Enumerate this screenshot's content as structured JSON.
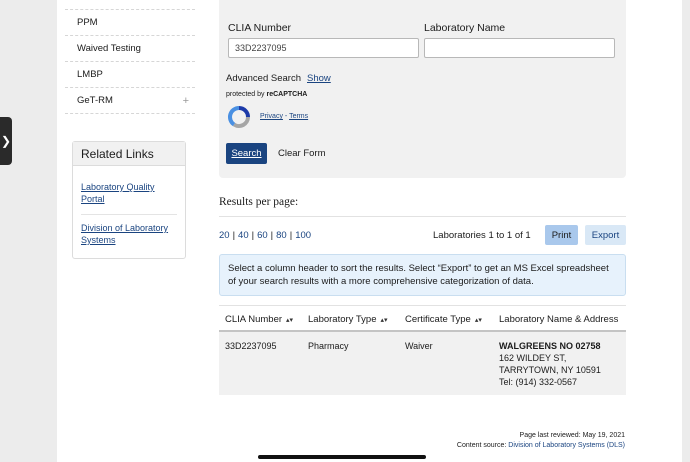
{
  "nav": {
    "items": [
      {
        "label": "PPM",
        "expandable": false
      },
      {
        "label": "Waived Testing",
        "expandable": false
      },
      {
        "label": "LMBP",
        "expandable": false
      },
      {
        "label": "GeT-RM",
        "expandable": true
      }
    ],
    "expand_symbol": "+"
  },
  "related_links": {
    "title": "Related Links",
    "links": [
      "Laboratory Quality Portal",
      "Division of Laboratory Systems"
    ]
  },
  "search": {
    "clia_label": "CLIA Number",
    "clia_value": "33D2237095",
    "lab_name_label": "Laboratory Name",
    "lab_name_value": "",
    "advanced_label": "Advanced Search",
    "advanced_toggle": "Show",
    "protected_prefix": "protected by",
    "protected_brand": "reCAPTCHA",
    "privacy": "Privacy",
    "terms": "Terms",
    "privacy_sep": " - ",
    "search_button": "Search",
    "clear_button": "Clear Form"
  },
  "results": {
    "per_page_label": "Results per page:",
    "page_sizes": [
      "20",
      "40",
      "60",
      "80",
      "100"
    ],
    "count_text": "Laboratories 1 to 1 of 1",
    "print_button": "Print",
    "export_button": "Export",
    "info_text": "Select a column header to sort the results. Select “Export” to get an MS Excel spreadsheet of your search results with a more comprehensive categorization of data.",
    "columns": [
      "CLIA Number",
      "Laboratory Type",
      "Certificate Type",
      "Laboratory Name & Address"
    ],
    "rows": [
      {
        "clia": "33D2237095",
        "lab_type": "Pharmacy",
        "cert_type": "Waiver",
        "name": "WALGREENS NO 02758",
        "address1": "162 WILDEY ST,",
        "address2": "TARRYTOWN, NY  10591",
        "tel": "Tel: (914) 332-0567"
      }
    ]
  },
  "footer": {
    "reviewed": "Page last reviewed: May 19, 2021",
    "source_prefix": "Content source: ",
    "source_link": "Division of Laboratory Systems (DLS)"
  },
  "colors": {
    "primary": "#1a4480",
    "panel": "#f1f1f1",
    "info_bg": "#e7f2fc"
  }
}
